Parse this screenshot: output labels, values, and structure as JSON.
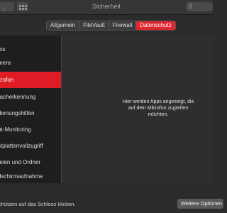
{
  "window": {
    "title": "Sicherheit"
  },
  "tabs": [
    {
      "label": "Allgemein"
    },
    {
      "label": "FileVault"
    },
    {
      "label": "Firewall"
    },
    {
      "label": "Datenschutz"
    }
  ],
  "sidebar": {
    "items": [
      {
        "label": "tos"
      },
      {
        "label": "mera"
      },
      {
        "label": "krofon"
      },
      {
        "label": "racherkennung"
      },
      {
        "label": "dienungshilfen"
      },
      {
        "label": "ut-Monitoring"
      },
      {
        "label": "stplattenvollzugriff"
      },
      {
        "label": "teien und Ordner"
      },
      {
        "label": "dschirmaufnahme"
      }
    ]
  },
  "content": {
    "message_line1": "Hier werden Apps angezeigt, die",
    "message_line2": "auf dein Mikrofon zugreifen",
    "message_line3": "möchten."
  },
  "footer": {
    "lock_text": "chützen auf das Schloss klicken.",
    "advanced_label": "Weitere Optionen"
  },
  "colors": {
    "accent": "#e0262e",
    "selected": "#dd1c26"
  }
}
